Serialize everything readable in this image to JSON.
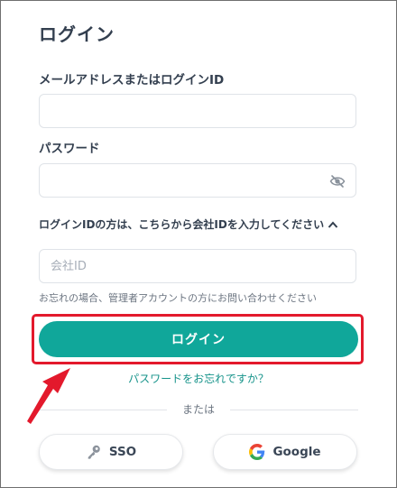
{
  "title": "ログイン",
  "email": {
    "label": "メールアドレスまたはログインID",
    "value": "",
    "placeholder": ""
  },
  "password": {
    "label": "パスワード",
    "value": "",
    "placeholder": "",
    "visibility_icon": "eye-off-icon"
  },
  "company": {
    "toggle_label": "ログインIDの方は、こちらから会社IDを入力してください",
    "toggle_icon": "chevron-up-icon",
    "placeholder": "会社ID",
    "value": "",
    "hint": "お忘れの場合、管理者アカウントの方にお問い合わせください"
  },
  "login_button": {
    "label": "ログイン",
    "color": "#10a79a"
  },
  "forgot_link": "パスワードをお忘れですか？",
  "divider_text": "または",
  "sso_button": {
    "label": "SSO",
    "icon": "key-icon"
  },
  "google_button": {
    "label": "Google",
    "icon": "google-logo-icon"
  },
  "annotation": {
    "highlight_color": "#e3192c",
    "arrow_icon": "red-arrow-icon"
  }
}
